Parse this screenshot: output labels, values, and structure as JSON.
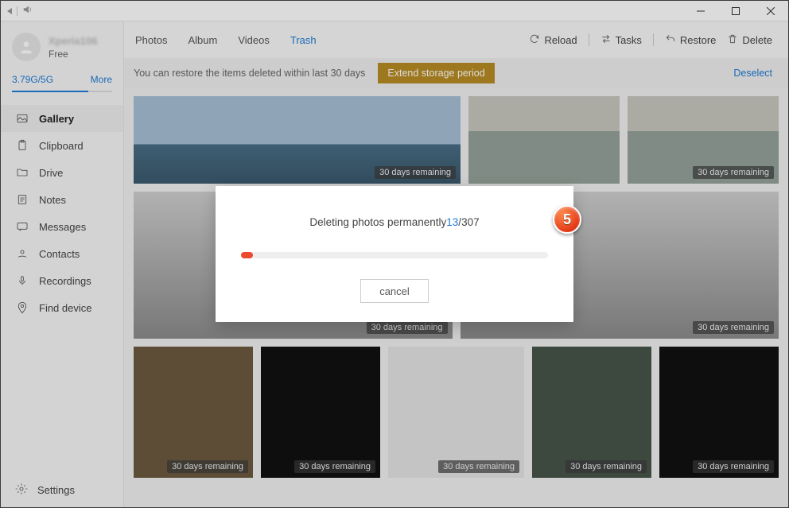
{
  "titlebar": {
    "app_hint": ""
  },
  "profile": {
    "name": "Xperia106",
    "tier": "Free"
  },
  "storage": {
    "usage": "3.79G/5G",
    "more": "More",
    "fill_pct": 76
  },
  "sidebar": {
    "items": [
      {
        "label": "Gallery"
      },
      {
        "label": "Clipboard"
      },
      {
        "label": "Drive"
      },
      {
        "label": "Notes"
      },
      {
        "label": "Messages"
      },
      {
        "label": "Contacts"
      },
      {
        "label": "Recordings"
      },
      {
        "label": "Find device"
      }
    ],
    "settings": "Settings"
  },
  "tabs": [
    {
      "label": "Photos"
    },
    {
      "label": "Album"
    },
    {
      "label": "Videos"
    },
    {
      "label": "Trash"
    }
  ],
  "actions": {
    "reload": "Reload",
    "tasks": "Tasks",
    "restore": "Restore",
    "delete": "Delete"
  },
  "notice": {
    "text": "You can restore the items deleted within last 30 days",
    "extend": "Extend storage period",
    "deselect": "Deselect"
  },
  "badge": "30 days remaining",
  "dialog": {
    "prefix": "Deleting photos permanently",
    "current": "13",
    "sep": "/",
    "total": "307",
    "progress_pct": 4,
    "cancel": "cancel",
    "callout": "5"
  }
}
